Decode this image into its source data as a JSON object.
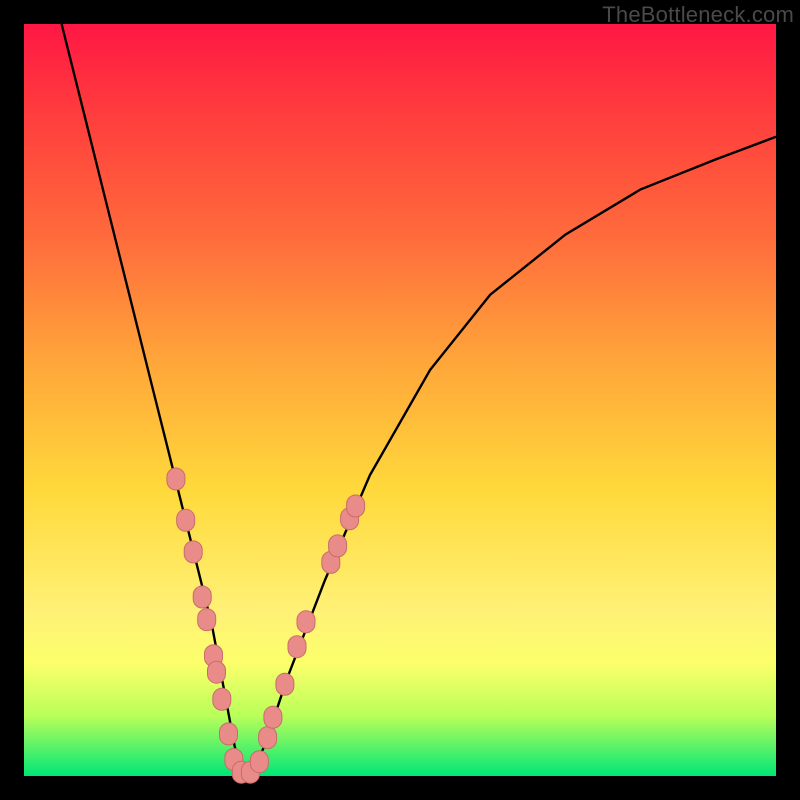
{
  "watermark": "TheBottleneck.com",
  "colors": {
    "frame": "#000000",
    "curve_stroke": "#000000",
    "marker_fill": "#e98b88",
    "marker_stroke": "#c96c69"
  },
  "chart_data": {
    "type": "line",
    "title": "",
    "xlabel": "",
    "ylabel": "",
    "xlim": [
      0,
      100
    ],
    "ylim": [
      0,
      100
    ],
    "note": "V-shaped bottleneck curve; y is bottleneck %, x is nominal balance parameter. Values estimated from pixel positions; no axis ticks shown in source image.",
    "series": [
      {
        "name": "bottleneck-curve",
        "x": [
          5,
          8,
          11,
          14,
          17,
          19,
          21,
          23,
          25,
          26.5,
          28,
          29,
          30,
          32,
          35,
          40,
          46,
          54,
          62,
          72,
          82,
          92,
          100
        ],
        "y": [
          100,
          88,
          76,
          64,
          52,
          44,
          36,
          28,
          20,
          12,
          4,
          0,
          0,
          4,
          13,
          26,
          40,
          54,
          64,
          72,
          78,
          82,
          85
        ]
      }
    ],
    "markers": [
      {
        "x": 20.2,
        "y": 39.5
      },
      {
        "x": 21.5,
        "y": 34.0
      },
      {
        "x": 22.5,
        "y": 29.8
      },
      {
        "x": 23.7,
        "y": 23.8
      },
      {
        "x": 24.3,
        "y": 20.8
      },
      {
        "x": 25.2,
        "y": 16.0
      },
      {
        "x": 25.6,
        "y": 13.8
      },
      {
        "x": 26.3,
        "y": 10.2
      },
      {
        "x": 27.2,
        "y": 5.6
      },
      {
        "x": 27.9,
        "y": 2.2
      },
      {
        "x": 28.9,
        "y": 0.5
      },
      {
        "x": 30.1,
        "y": 0.5
      },
      {
        "x": 31.3,
        "y": 1.9
      },
      {
        "x": 32.4,
        "y": 5.1
      },
      {
        "x": 33.1,
        "y": 7.8
      },
      {
        "x": 34.7,
        "y": 12.2
      },
      {
        "x": 36.3,
        "y": 17.2
      },
      {
        "x": 37.5,
        "y": 20.5
      },
      {
        "x": 40.8,
        "y": 28.4
      },
      {
        "x": 41.7,
        "y": 30.6
      },
      {
        "x": 43.3,
        "y": 34.2
      },
      {
        "x": 44.1,
        "y": 35.9
      }
    ]
  }
}
